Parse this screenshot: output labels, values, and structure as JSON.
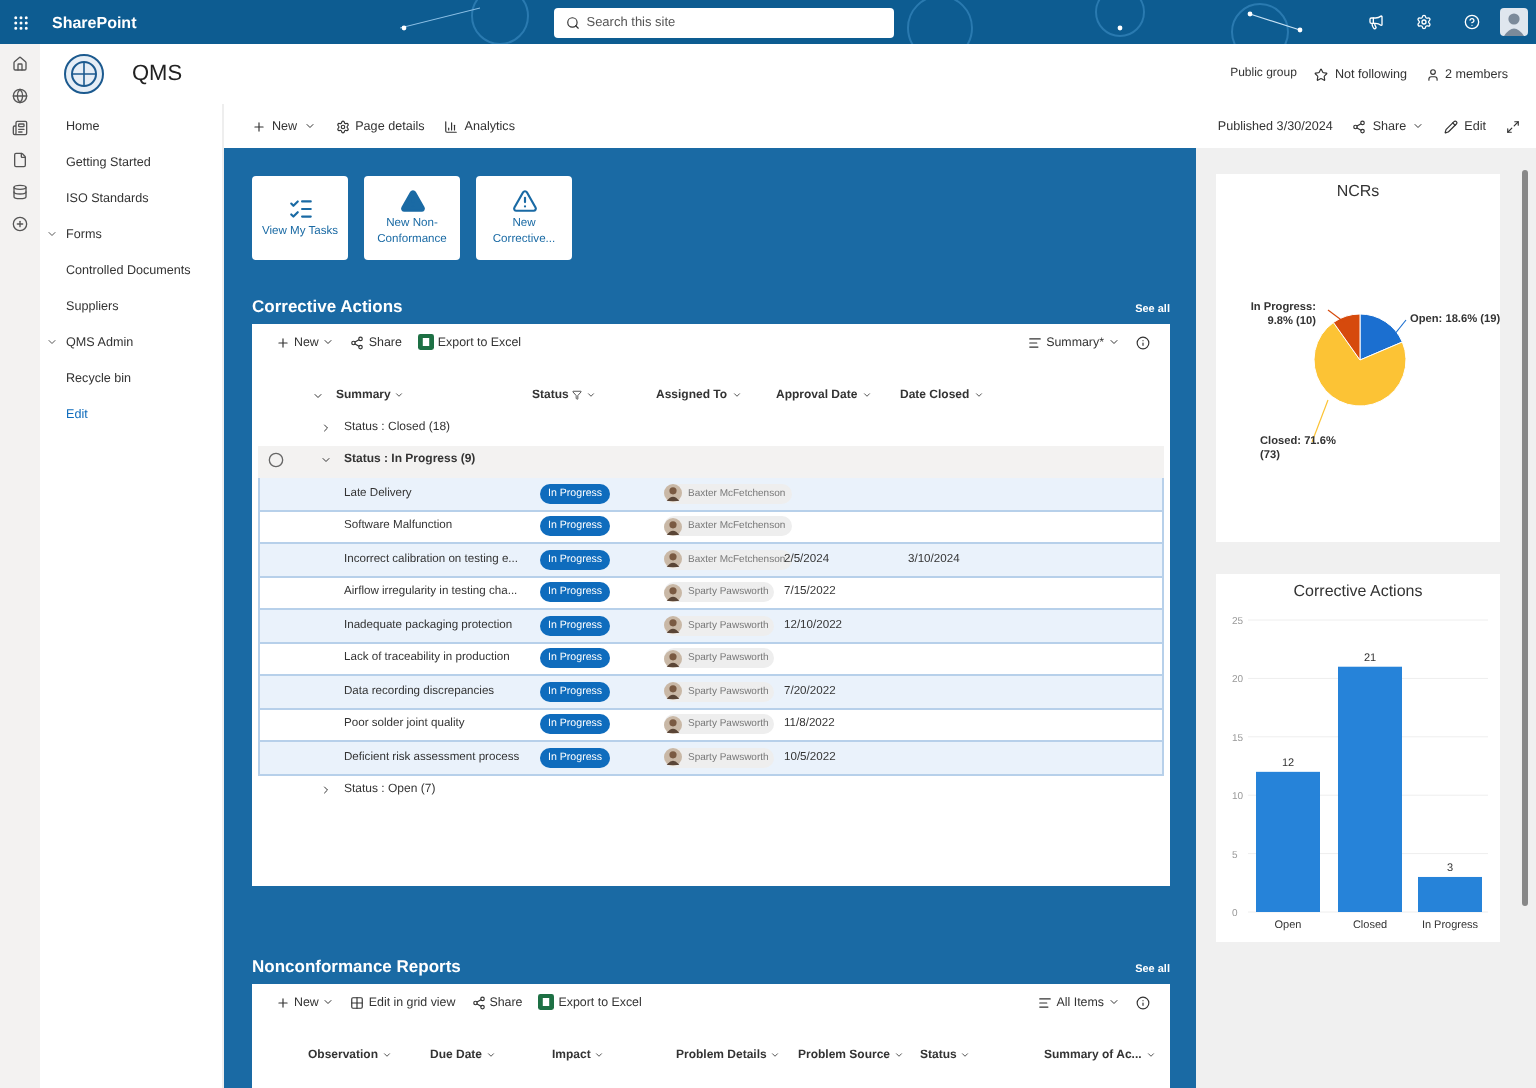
{
  "topbar": {
    "app_name": "SharePoint",
    "search": {
      "placeholder": "Search this site"
    }
  },
  "site": {
    "title": "QMS",
    "group_type": "Public group",
    "follow": "Not following",
    "members": "2 members"
  },
  "nav": [
    {
      "label": "Home",
      "kind": "link"
    },
    {
      "label": "Getting Started",
      "kind": "link"
    },
    {
      "label": "ISO Standards",
      "kind": "link"
    },
    {
      "label": "Forms",
      "kind": "group",
      "expanded": true
    },
    {
      "label": "Controlled Documents",
      "kind": "link"
    },
    {
      "label": "Suppliers",
      "kind": "link"
    },
    {
      "label": "QMS Admin",
      "kind": "group",
      "expanded": true
    },
    {
      "label": "Recycle bin",
      "kind": "link"
    },
    {
      "label": "Edit",
      "kind": "edit"
    }
  ],
  "page_commands": [
    "New",
    "Page details",
    "Analytics"
  ],
  "page_status": {
    "published": "Published 3/30/2024",
    "share": "Share",
    "edit": "Edit"
  },
  "quick_links": [
    {
      "label": "View My Tasks"
    },
    {
      "label": "New Non-Conformance"
    },
    {
      "label": "New Corrective..."
    }
  ],
  "corrective_actions": {
    "title": "Corrective Actions",
    "see_all": "See all",
    "toolbar": [
      "New",
      "Share",
      "Export to Excel"
    ],
    "view": "Summary*",
    "columns": [
      "Summary",
      "Status",
      "Assigned To",
      "Approval Date",
      "Date Closed"
    ],
    "groups": [
      {
        "label": "Status : Closed (18)",
        "expanded": false
      },
      {
        "label": "Status : In Progress (9)",
        "expanded": true,
        "rows": [
          {
            "summary": "Late Delivery",
            "status": "In Progress",
            "assigned_to": "Baxter McFetchenson",
            "approval_date": "",
            "date_closed": ""
          },
          {
            "summary": "Software Malfunction",
            "status": "In Progress",
            "assigned_to": "Baxter McFetchenson",
            "approval_date": "",
            "date_closed": ""
          },
          {
            "summary": "Incorrect calibration on testing e...",
            "status": "In Progress",
            "assigned_to": "Baxter McFetchenson",
            "approval_date": "2/5/2024",
            "date_closed": "3/10/2024"
          },
          {
            "summary": "Airflow irregularity in testing cha...",
            "status": "In Progress",
            "assigned_to": "Sparty Pawsworth",
            "approval_date": "7/15/2022",
            "date_closed": ""
          },
          {
            "summary": "Inadequate packaging protection",
            "status": "In Progress",
            "assigned_to": "Sparty Pawsworth",
            "approval_date": "12/10/2022",
            "date_closed": ""
          },
          {
            "summary": "Lack of traceability in production",
            "status": "In Progress",
            "assigned_to": "Sparty Pawsworth",
            "approval_date": "",
            "date_closed": ""
          },
          {
            "summary": "Data recording discrepancies",
            "status": "In Progress",
            "assigned_to": "Sparty Pawsworth",
            "approval_date": "7/20/2022",
            "date_closed": ""
          },
          {
            "summary": "Poor solder joint quality",
            "status": "In Progress",
            "assigned_to": "Sparty Pawsworth",
            "approval_date": "11/8/2022",
            "date_closed": ""
          },
          {
            "summary": "Deficient risk assessment process",
            "status": "In Progress",
            "assigned_to": "Sparty Pawsworth",
            "approval_date": "10/5/2022",
            "date_closed": ""
          }
        ]
      },
      {
        "label": "Status : Open (7)",
        "expanded": false
      }
    ]
  },
  "nonconformance_reports": {
    "title": "Nonconformance Reports",
    "see_all": "See all",
    "toolbar": [
      "New",
      "Edit in grid view",
      "Share",
      "Export to Excel"
    ],
    "view": "All Items",
    "columns": [
      "Observation",
      "Due Date",
      "Impact",
      "Problem Details",
      "Problem Source",
      "Status",
      "Summary of Ac..."
    ]
  },
  "ncr_chart": {
    "chart_data": {
      "type": "pie",
      "title": "NCRs",
      "values": [
        18.6,
        71.6,
        9.8
      ],
      "value_labels": [
        "Open: 18.6% (19)",
        "Closed: 71.6% (73)",
        "In Progress: 9.8% (10)"
      ]
    }
  },
  "ca_chart": {
    "chart_data": {
      "type": "bar",
      "title": "Corrective Actions",
      "categories": [
        "Open",
        "Closed",
        "In Progress"
      ],
      "series": [
        {
          "color": "#2683d9",
          "values": [
            12,
            21,
            3
          ]
        }
      ],
      "ylim": [
        0,
        25
      ],
      "yticks": [
        0,
        5,
        10,
        15,
        20,
        25
      ],
      "grid": true,
      "data_labels": true
    }
  }
}
